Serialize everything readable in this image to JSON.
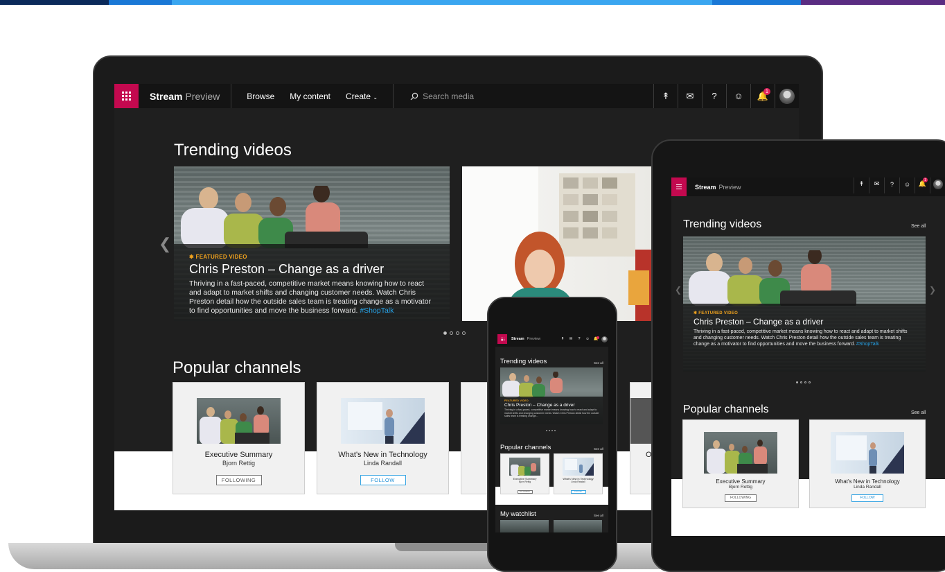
{
  "stripe_colors": [
    "#0b2a5a",
    "#1a78d6",
    "#3aa6f0",
    "#1a78d6",
    "#5a2c82"
  ],
  "laptop": {
    "nav": {
      "brand": "Stream",
      "brand_suffix": "Preview",
      "links": [
        "Browse",
        "My content",
        "Create"
      ],
      "search_placeholder": "Search media",
      "notification_count": "1"
    },
    "trending_title": "Trending videos",
    "featured": {
      "tag": "FEATURED VIDEO",
      "title": "Chris Preston – Change as a driver",
      "description": "Thriving in a fast-paced, competitive market means knowing how to react and adapt to market shifts and changing customer needs. Watch Chris Preston detail how the outside sales team is treating change as a motivator to find opportunities and move the business forward.",
      "hashtag": "#ShopTalk"
    },
    "popular_title": "Popular channels",
    "channels": [
      {
        "name": "Executive Summary",
        "owner": "Bjorn Rettig",
        "button": "FOLLOWING"
      },
      {
        "name": "What's New in Technology",
        "owner": "Linda Randall",
        "button": "FOLLOW"
      }
    ],
    "partial_card_text": "O"
  },
  "tablet": {
    "brand": "Stream",
    "brand_suffix": "Preview",
    "notification_count": "1",
    "trending_title": "Trending videos",
    "see_all": "See all",
    "featured": {
      "tag": "FEATURED VIDEO",
      "title": "Chris Preston – Change as a driver",
      "description": "Thriving in a fast-paced, competitive market means knowing how to react and adapt to market shifts and changing customer needs. Watch Chris Preston detail how the outside sales team is treating change as a motivator to find opportunities and move the business forward.",
      "hashtag": "#ShopTalk"
    },
    "popular_title": "Popular channels",
    "channels": [
      {
        "name": "Executive Summary",
        "owner": "Bjorn Rettig",
        "button": "FOLLOWING"
      },
      {
        "name": "What's New in Technology",
        "owner": "Linda Randall",
        "button": "FOLLOW"
      }
    ]
  },
  "phone": {
    "brand": "Stream",
    "brand_suffix": "Preview",
    "trending_title": "Trending videos",
    "see_all": "See all",
    "featured": {
      "tag": "FEATURED VIDEO",
      "title": "Chris Preston – Change as a driver",
      "description": "Thriving in a fast-paced, competitive market means knowing how to react and adapt to market shifts and changing customer needs. Watch Chris Preston detail how the outside sales team is treating change..."
    },
    "popular_title": "Popular channels",
    "channels": [
      {
        "name": "Executive Summary",
        "owner": "Bjorn Rettig",
        "button": "FOLLOWING"
      },
      {
        "name": "What's New in Technology",
        "owner": "Linda Randall",
        "button": "FOLLOW"
      }
    ],
    "watchlist_title": "My watchlist"
  }
}
